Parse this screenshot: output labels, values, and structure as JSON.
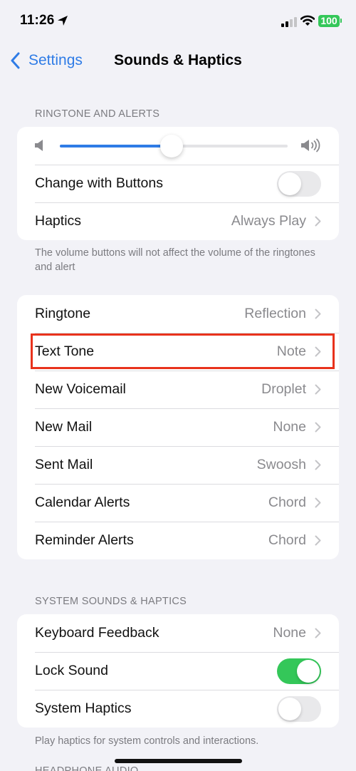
{
  "status_bar": {
    "time": "11:26",
    "location_icon": "location-arrow-icon",
    "signal_icon": "cellular-signal-icon",
    "wifi_icon": "wifi-icon",
    "battery_level": "100",
    "battery_color": "#34c759"
  },
  "nav": {
    "back_label": "Settings",
    "title": "Sounds & Haptics",
    "accent_color": "#2f7ce6"
  },
  "ringtone_alerts": {
    "header": "RINGTONE AND ALERTS",
    "volume_percent": 49,
    "change_with_buttons": {
      "label": "Change with Buttons",
      "on": false
    },
    "haptics": {
      "label": "Haptics",
      "value": "Always Play"
    },
    "footer": "The volume buttons will not affect the volume of the ringtones and alert"
  },
  "sounds": {
    "items": [
      {
        "label": "Ringtone",
        "value": "Reflection"
      },
      {
        "label": "Text Tone",
        "value": "Note",
        "highlighted": true
      },
      {
        "label": "New Voicemail",
        "value": "Droplet"
      },
      {
        "label": "New Mail",
        "value": "None"
      },
      {
        "label": "Sent Mail",
        "value": "Swoosh"
      },
      {
        "label": "Calendar Alerts",
        "value": "Chord"
      },
      {
        "label": "Reminder Alerts",
        "value": "Chord"
      }
    ],
    "highlight_color": "#e8321c"
  },
  "system": {
    "header": "SYSTEM SOUNDS & HAPTICS",
    "keyboard_feedback": {
      "label": "Keyboard Feedback",
      "value": "None"
    },
    "lock_sound": {
      "label": "Lock Sound",
      "on": true
    },
    "system_haptics": {
      "label": "System Haptics",
      "on": false
    },
    "footer": "Play haptics for system controls and interactions."
  },
  "headphone": {
    "header": "HEADPHONE AUDIO"
  }
}
